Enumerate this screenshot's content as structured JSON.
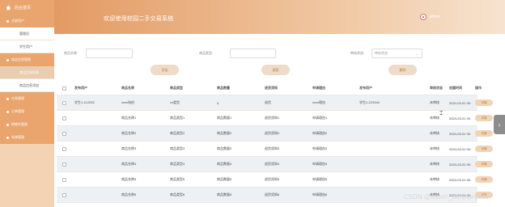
{
  "sidebar": {
    "home_label": "后台首页",
    "items": [
      {
        "label": "注册用户",
        "type": "parent"
      },
      {
        "label": "管理员",
        "type": "sub"
      },
      {
        "label": "学生用户",
        "type": "sub"
      },
      {
        "label": "商品信息管理",
        "type": "parent"
      },
      {
        "label": "商品信息列表",
        "type": "sub-active"
      },
      {
        "label": "商品信息添加",
        "type": "sub"
      },
      {
        "label": "交易管理",
        "type": "parent"
      },
      {
        "label": "订单管理",
        "type": "parent"
      },
      {
        "label": "购物车管理",
        "type": "parent"
      },
      {
        "label": "系统管理",
        "type": "parent"
      }
    ]
  },
  "header": {
    "title": "欢迎使用校园二手交易系统",
    "username": "admin"
  },
  "search": {
    "field1_label": "商品名称:",
    "field2_label": "商品类型:",
    "field3_label": "审核状态:",
    "field3_value": "审核状态",
    "btn_search": "搜索",
    "btn_add": "添加",
    "btn_delete": "删除"
  },
  "table": {
    "headers": [
      "发布用户",
      "商品名称",
      "商品类型",
      "商品数量",
      "退货须知",
      "申请理由",
      "发布用户",
      "审核状态",
      "创建时间",
      "操作"
    ],
    "rows": [
      [
        "学生1-112233",
        "xxxx电机",
        "xx类型",
        "4",
        "退货",
        "xxxx理由",
        "学生2-223344",
        "未审核",
        "2024-03-01 00:",
        "详情"
      ],
      [
        "",
        "商品名称1",
        "商品类型1",
        "商品数量1",
        "退货须知1",
        "申请理由1",
        "",
        "未审核",
        "2024-03-01 00:",
        "详情"
      ],
      [
        "",
        "商品名称2",
        "商品类型2",
        "商品数量2",
        "退货须知2",
        "申请理由2",
        "",
        "未审核",
        "2024-03-01 00:",
        "详情"
      ],
      [
        "",
        "商品名称3",
        "商品类型3",
        "商品数量3",
        "退货须知3",
        "申请理由3",
        "",
        "未审核",
        "2024-03-01 00:",
        "详情"
      ],
      [
        "",
        "商品名称4",
        "商品类型4",
        "商品数量4",
        "退货须知4",
        "申请理由4",
        "",
        "未审核",
        "2024-03-01 00:",
        "详情"
      ],
      [
        "",
        "商品名称5",
        "商品类型5",
        "商品数量5",
        "退货须知5",
        "申请理由5",
        "",
        "未审核",
        "2024-03-01 00:",
        "详情"
      ],
      [
        "",
        "商品名称6",
        "商品类型6",
        "商品数量6",
        "退货须知6",
        "申请理由6",
        "",
        "未审核",
        "2024-03-01 00:",
        "详情"
      ]
    ]
  },
  "watermark": "CSDN @weixin_danpianji889",
  "colors": {
    "accent": "#e9a56d",
    "sidebar_bg": "#f3d3b3",
    "button_bg": "#eedcc8"
  }
}
